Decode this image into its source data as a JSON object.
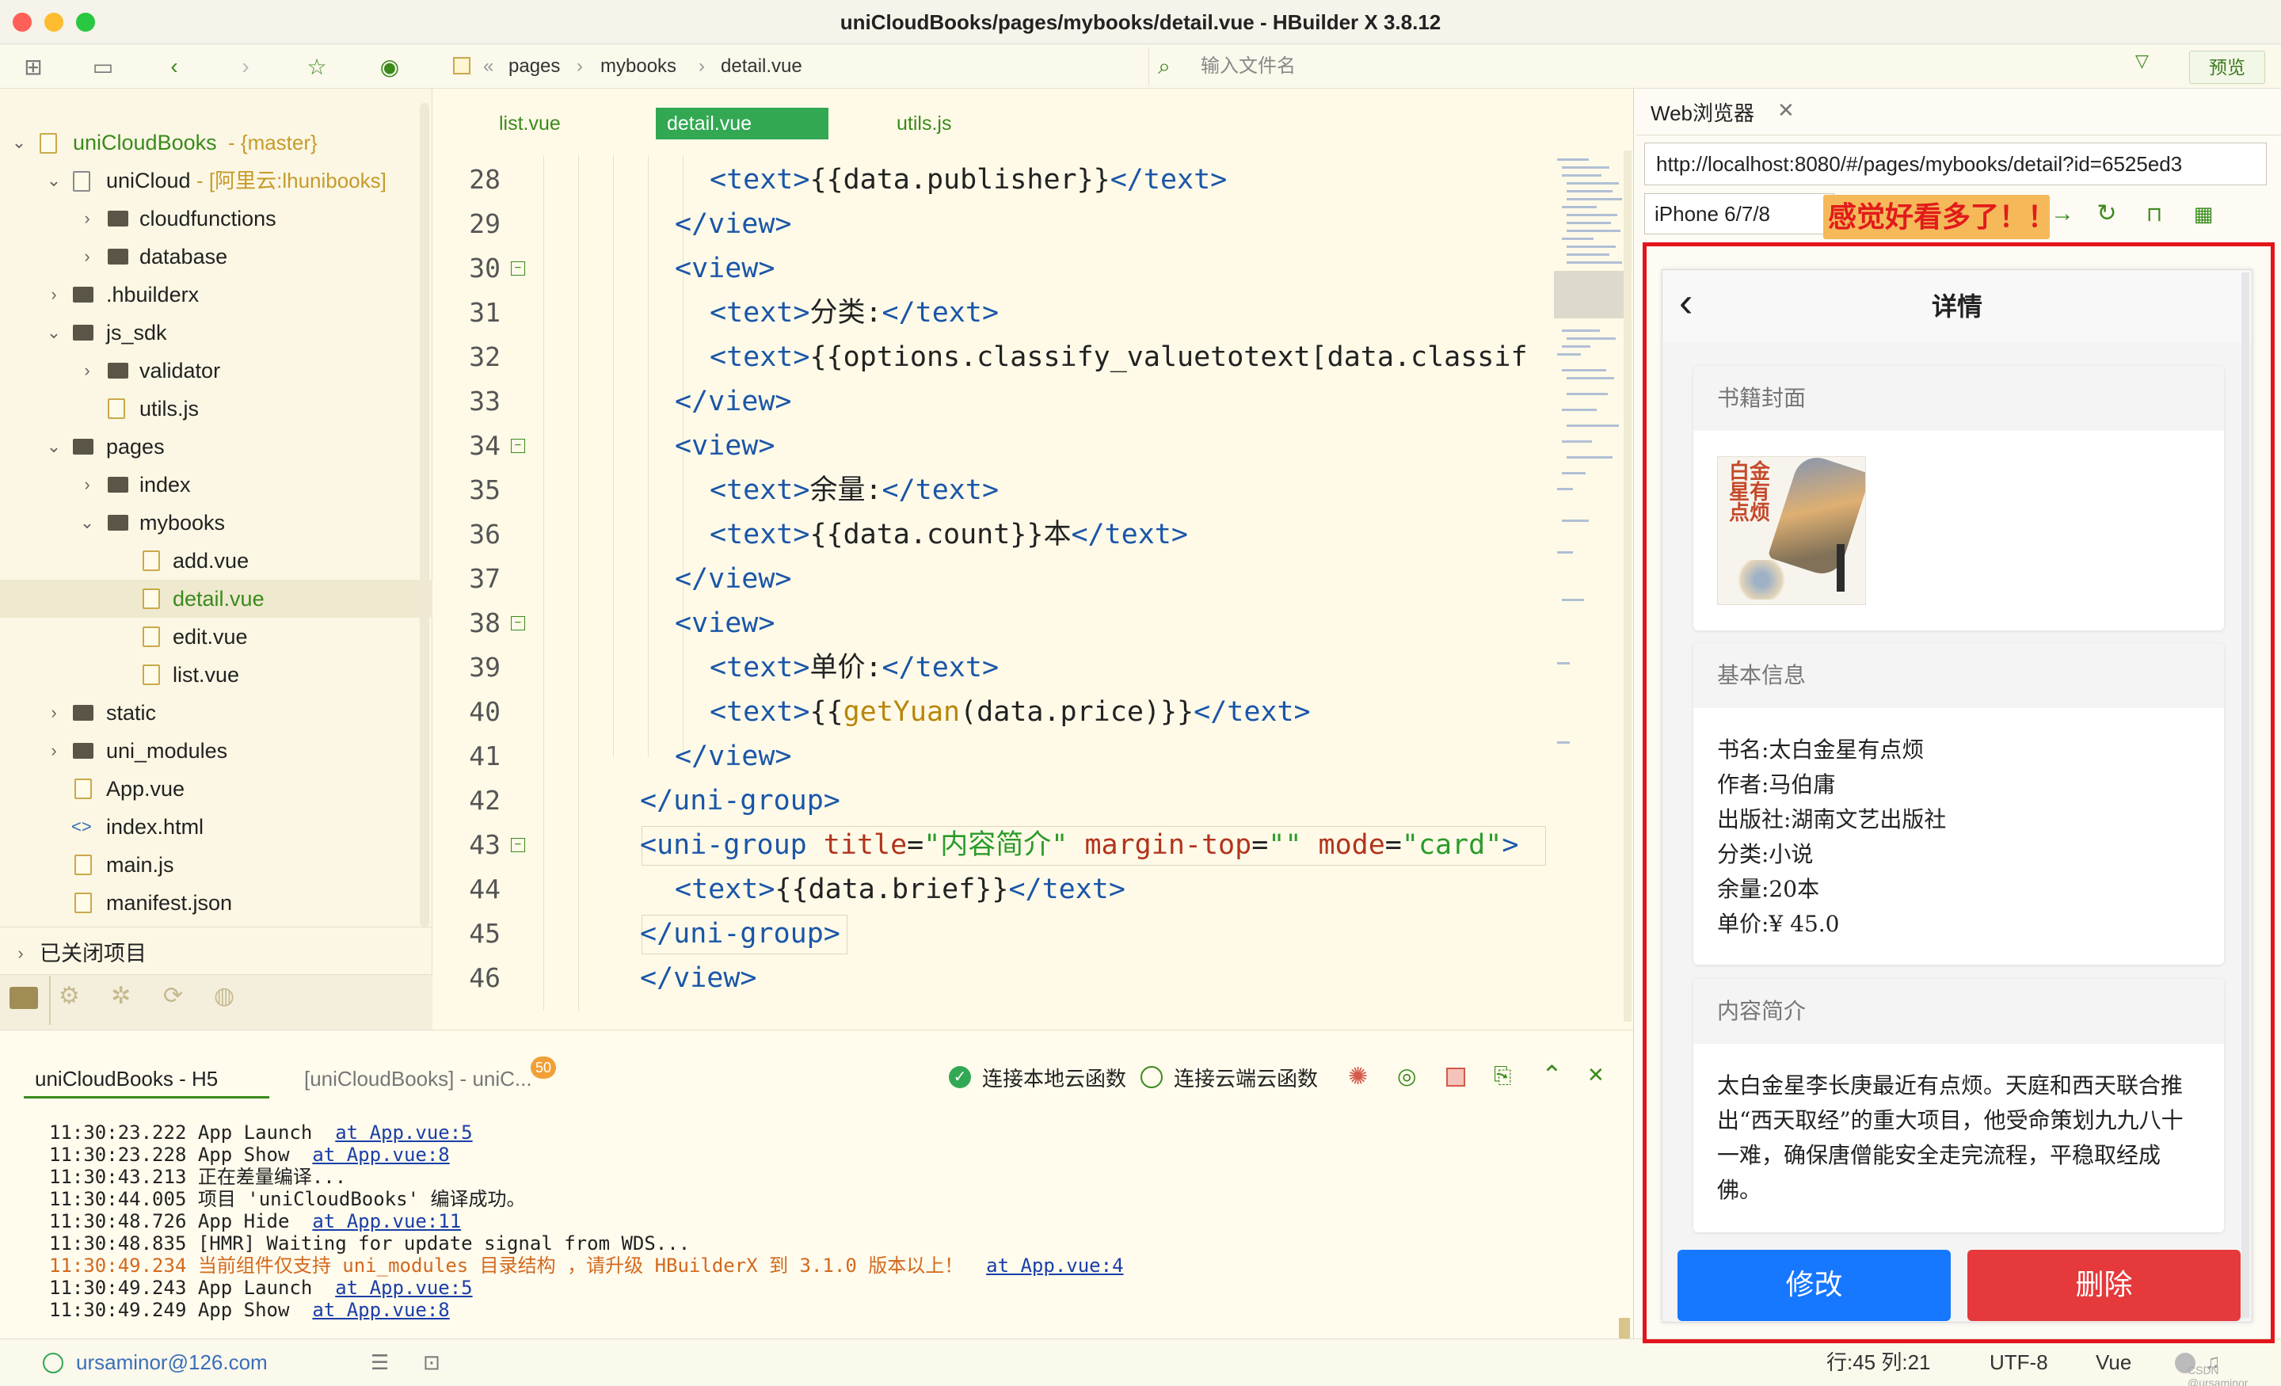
{
  "window": {
    "title": "uniCloudBooks/pages/mybooks/detail.vue - HBuilder X 3.8.12",
    "traffic_colors": [
      "#fe5f57",
      "#febc2e",
      "#28c840"
    ]
  },
  "toolbar": {
    "breadcrumb": [
      "pages",
      "mybooks",
      "detail.vue"
    ],
    "breadcrumb_prefix": "«",
    "file_search_placeholder": "输入文件名",
    "preview_label": "预览"
  },
  "sidebar": {
    "items": [
      {
        "label": "uniCloudBooks",
        "suffix": " - {master}",
        "green": true
      },
      {
        "label": "uniCloud",
        "suffix": " - [阿里云:lhunibooks]"
      },
      {
        "label": "cloudfunctions"
      },
      {
        "label": "database"
      },
      {
        "label": ".hbuilderx"
      },
      {
        "label": "js_sdk"
      },
      {
        "label": "validator"
      },
      {
        "label": "utils.js"
      },
      {
        "label": "pages"
      },
      {
        "label": "index"
      },
      {
        "label": "mybooks"
      },
      {
        "label": "add.vue"
      },
      {
        "label": "detail.vue",
        "green": true
      },
      {
        "label": "edit.vue"
      },
      {
        "label": "list.vue"
      },
      {
        "label": "static"
      },
      {
        "label": "uni_modules"
      },
      {
        "label": "App.vue"
      },
      {
        "label": "index.html"
      },
      {
        "label": "main.js"
      },
      {
        "label": "manifest.json"
      }
    ],
    "closed_projects_label": "已关闭项目"
  },
  "editor": {
    "tabs": [
      "list.vue",
      "detail.vue",
      "utils.js"
    ],
    "active_tab": "detail.vue",
    "line_numbers": [
      "28",
      "29",
      "30",
      "31",
      "32",
      "33",
      "34",
      "35",
      "36",
      "37",
      "38",
      "39",
      "40",
      "41",
      "42",
      "43",
      "44",
      "45",
      "46"
    ]
  },
  "code": {
    "l28_open": "<text>",
    "l28_mid": "{{data.publisher}}",
    "l28_close": "</text>",
    "l29": "</view>",
    "l30": "<view>",
    "l31_open": "<text>",
    "l31_mid": "分类:",
    "l31_close": "</text>",
    "l32_open": "<text>",
    "l32_mid": "{{options.classify_valuetotext[data.classif",
    "l33": "</view>",
    "l34": "<view>",
    "l35_open": "<text>",
    "l35_mid": "余量:",
    "l35_close": "</text>",
    "l36_open": "<text>",
    "l36_mid": "{{data.count}}本",
    "l36_close": "</text>",
    "l37": "</view>",
    "l38": "<view>",
    "l39_open": "<text>",
    "l39_mid": "单价:",
    "l39_close": "</text>",
    "l40_open": "<text>",
    "l40_mid1": "{{",
    "l40_fn": "getYuan",
    "l40_mid2": "(data.price)}}",
    "l40_close": "</text>",
    "l41": "</view>",
    "l42": "</uni-group>",
    "l43_tag": "<uni-group",
    "l43_a1": "title",
    "l43_eq1": "=",
    "l43_v1": "\"内容简介\"",
    "l43_a2": "margin-top",
    "l43_eq2": "=",
    "l43_v2": "\"\"",
    "l43_a3": "mode",
    "l43_eq3": "=",
    "l43_v3": "\"card\"",
    "l43_end": ">",
    "l44_open": "<text>",
    "l44_mid": "{{data.brief}}",
    "l44_close": "</text>",
    "l45": "</uni-group>",
    "l46": "</view>"
  },
  "console": {
    "tab_active": "uniCloudBooks - H5",
    "tab_other": "[uniCloudBooks] - uniC...",
    "badge": "50",
    "local_label": "连接本地云函数",
    "cloud_label": "连接云端云函数",
    "logs": [
      {
        "text": "11:30:23.222 App Launch  ",
        "link": "at App.vue:5"
      },
      {
        "text": "11:30:23.228 App Show  ",
        "link": "at App.vue:8"
      },
      {
        "text": "11:30:43.213 正在差量编译...",
        "link": ""
      },
      {
        "text": "11:30:44.005 项目 'uniCloudBooks' 编译成功。",
        "link": ""
      },
      {
        "text": "11:30:48.726 App Hide  ",
        "link": "at App.vue:11"
      },
      {
        "text": "11:30:48.835 [HMR] Waiting for update signal from WDS...",
        "link": ""
      },
      {
        "text": "11:30:49.234 当前组件仅支持 uni_modules 目录结构 ，请升级 HBuilderX 到 3.1.0 版本以上！  ",
        "link": "at App.vue:4",
        "warn": true
      },
      {
        "text": "11:30:49.243 App Launch  ",
        "link": "at App.vue:5"
      },
      {
        "text": "11:30:49.249 App Show  ",
        "link": "at App.vue:8"
      }
    ]
  },
  "status": {
    "user": "ursaminor@126.com",
    "position": "行:45  列:21",
    "encoding": "UTF-8",
    "language": "Vue",
    "watermark": "CSDN @ursaminor"
  },
  "browser": {
    "tab_label": "Web浏览器",
    "url": "http://localhost:8080/#/pages/mybooks/detail?id=6525ed3",
    "device": "iPhone 6/7/8",
    "tip": "感觉好看多了！！",
    "accent": "#e4141b"
  },
  "phone": {
    "title": "详情",
    "cover_header": "书籍封面",
    "cover_text": "白金星有点烦",
    "info_header": "基本信息",
    "info": [
      "书名:太白金星有点烦",
      "作者:马伯庸",
      "出版社:湖南文艺出版社",
      "分类:小说",
      "余量:20本",
      "单价:¥ 45.0"
    ],
    "brief_header": "内容简介",
    "brief_lines": [
      "太白金星李长庚最近有点烦。天庭和西天联合推",
      "出“西天取经”的重大项目，他受命策划九九八十",
      "一难，确保唐僧能安全走完流程，平稳取经成",
      "佛。"
    ],
    "edit_label": "修改",
    "delete_label": "删除",
    "edit_color": "#1677ff",
    "delete_color": "#e5393b"
  }
}
